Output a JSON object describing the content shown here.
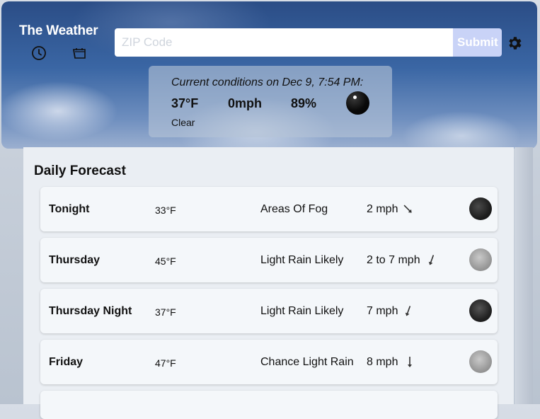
{
  "app": {
    "title": "The Weather"
  },
  "header": {
    "icons": [
      "clock-icon",
      "calendar-icon"
    ],
    "zip_placeholder": "ZIP Code",
    "zip_value": "",
    "submit_label": "Submit",
    "settings_icon": "gear-icon"
  },
  "current": {
    "title": "Current conditions on Dec 9, 7:54 PM:",
    "temperature": "37°F",
    "wind": "0mph",
    "humidity": "89%",
    "description": "Clear",
    "icon": "moon-icon"
  },
  "forecast": {
    "title": "Daily Forecast",
    "items": [
      {
        "name": "Tonight",
        "temp": "33°F",
        "desc": "Areas Of Fog",
        "wind": "2 mph",
        "arrow_deg": 135,
        "icon": "fog-night-icon"
      },
      {
        "name": "Thursday",
        "temp": "45°F",
        "desc": "Light Rain Likely",
        "wind": "2 to 7 mph",
        "arrow_deg": 200,
        "icon": "rain-icon"
      },
      {
        "name": "Thursday Night",
        "temp": "37°F",
        "desc": "Light Rain Likely",
        "wind": "7 mph",
        "arrow_deg": 200,
        "icon": "rain-night-icon"
      },
      {
        "name": "Friday",
        "temp": "47°F",
        "desc": "Chance Light Rain",
        "wind": "8 mph",
        "arrow_deg": 180,
        "icon": "rain-icon"
      }
    ]
  },
  "colors": {
    "submit_bg": "#c9d3f7",
    "panel_bg": "#eaeef3",
    "card_bg": "#f4f7fa"
  }
}
